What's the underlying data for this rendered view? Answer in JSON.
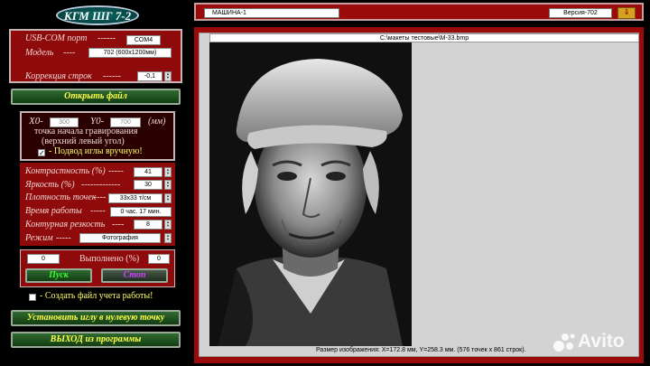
{
  "app": {
    "logo": "КГМ ШГ 7-2"
  },
  "settings": {
    "usb_label": "USB-COM порт",
    "usb_value": "COM4",
    "model_label": "Модель",
    "model_value": "702 (600x1200мм)",
    "row_corr_label": "Коррекция строк",
    "row_corr_value": "-0,1"
  },
  "open_file_label": "Открыть файл",
  "origin": {
    "x0_label": "X0-",
    "x0_value": "300",
    "y0_label": "Y0-",
    "y0_value": "700",
    "unit": "(мм)",
    "caption_line1": "точка начала гравирования",
    "caption_line2": "(верхний левый угол)",
    "manual_feed_label": "- Подвод иглы вручную!",
    "manual_feed_checked": "✓"
  },
  "params": {
    "contrast_label": "Контрастность (%)",
    "contrast_value": "41",
    "brightness_label": "Яркость (%)",
    "brightness_value": "30",
    "density_label": "Плотность точек",
    "density_value": "33x33 т/см",
    "worktime_label": "Время работы",
    "worktime_value": "0 час. 17 мин.",
    "sharpness_label": "Контурная резкость",
    "sharpness_value": "8",
    "mode_label": "Режим",
    "mode_value": "Фотография"
  },
  "progress": {
    "start_value": "0",
    "done_label": "Выполнено (%)",
    "done_value": "0",
    "start_btn": "Пуск",
    "stop_btn": "Стоп",
    "report_label": "- Создать файл учета работы!"
  },
  "zero_btn": "Установить иглу в нулевую точку",
  "exit_btn": "ВЫХОД из программы",
  "topbar": {
    "machine": "МАШИНА-1",
    "version": "Версия-702",
    "download_icon": "⇓"
  },
  "viewer": {
    "file_path": "C:\\макеты тестовые\\М-33.bmp",
    "status": "Размер изображения:  X=172.8 мм,  Y=258.3 мм.   (576 точек х 861 строк)."
  },
  "watermark": "Avito"
}
